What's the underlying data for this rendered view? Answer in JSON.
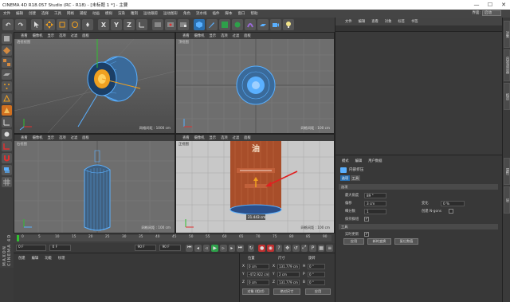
{
  "window": {
    "title": "CINEMA 4D R18.057 Studio (RC - R18) - [未标题 1 *] - 主要",
    "minimize": "—",
    "maximize": "☐",
    "close": "✕"
  },
  "menubar": {
    "items": [
      "文件",
      "编辑",
      "创建",
      "选择",
      "工具",
      "网格",
      "捕捉",
      "动画",
      "模拟",
      "渲染",
      "雕刻",
      "运动跟踪",
      "运动图形",
      "角色",
      "流水线",
      "插件",
      "脚本",
      "窗口",
      "帮助"
    ],
    "layout_label": "界面:",
    "layout_value": "启动"
  },
  "toolbar": {
    "undo": "↶",
    "redo": "↷",
    "x": "X",
    "y": "Y",
    "z": "Z"
  },
  "viewports": {
    "menu": [
      "查看",
      "摄像机",
      "显示",
      "选项",
      "过滤",
      "面板"
    ],
    "perspective": {
      "title": "透视视图",
      "grid": "网格间距 : 1000 cm"
    },
    "top": {
      "title": "顶视图",
      "grid": "网格间距 : 100 cm"
    },
    "right": {
      "title": "右视图",
      "grid": "网格间距 : 100 cm"
    },
    "front": {
      "title": "正视图",
      "grid": "网格间距 : 100 cm",
      "label_char": "油",
      "measure": "21.443 cm"
    }
  },
  "timeline": {
    "ticks": [
      "0",
      "5",
      "10",
      "15",
      "20",
      "25",
      "30",
      "35",
      "40",
      "45",
      "50",
      "55",
      "60",
      "65",
      "70",
      "75",
      "80",
      "85",
      "90"
    ],
    "current": "0 F"
  },
  "playback": {
    "start": "0 F",
    "current": "0 F",
    "end": "90 F",
    "end2": "90 F"
  },
  "materials": {
    "menu": [
      "创建",
      "编辑",
      "功能",
      "纹理"
    ]
  },
  "coordinates": {
    "col_position": "位置",
    "col_size": "尺寸",
    "col_rotation": "旋转",
    "rows": [
      {
        "axis": "X",
        "pos": "0 cm",
        "size": "131.779 cm",
        "rot_axis": "H",
        "rot": "0 °"
      },
      {
        "axis": "Y",
        "pos": "-472.922 cm",
        "size": "2 cm",
        "rot_axis": "P",
        "rot": "0 °"
      },
      {
        "axis": "Z",
        "pos": "0 cm",
        "size": "131.779 cm",
        "rot_axis": "B",
        "rot": "0 °"
      }
    ],
    "mode_select": "对象 (相对)",
    "size_select": "绝对尺寸",
    "apply": "应用"
  },
  "objects": {
    "menu": [
      "文件",
      "编辑",
      "查看",
      "对象",
      "标签",
      "书签"
    ]
  },
  "attributes": {
    "menu": [
      "模式",
      "编辑",
      "用户数据"
    ],
    "object_name": "内部挤压",
    "tabs": [
      "选项",
      "工具"
    ],
    "section_options": "选项",
    "max_angle_label": "最大角度",
    "max_angle": "89 °",
    "offset_label": "偏移",
    "offset": "3 cm",
    "subdiv_label": "细分数",
    "subdiv": "1",
    "preserve_label": "保持群组",
    "variance_label": "变化",
    "variance": "0 %",
    "ngon_label": "创建 N-gons",
    "section_tool": "工具",
    "realtime_label": "实时更新",
    "apply": "应用",
    "new": "新的变换",
    "reset": "复位数值"
  },
  "sidetabs": [
    "对象",
    "内容浏览器",
    "构造",
    "属性",
    "层"
  ],
  "brand": "MAXON CINEMA 4D",
  "colors": {
    "accent_blue": "#1e90ff",
    "axis_red": "#e03030",
    "axis_green": "#30c030",
    "selection_orange": "#f0a020"
  }
}
